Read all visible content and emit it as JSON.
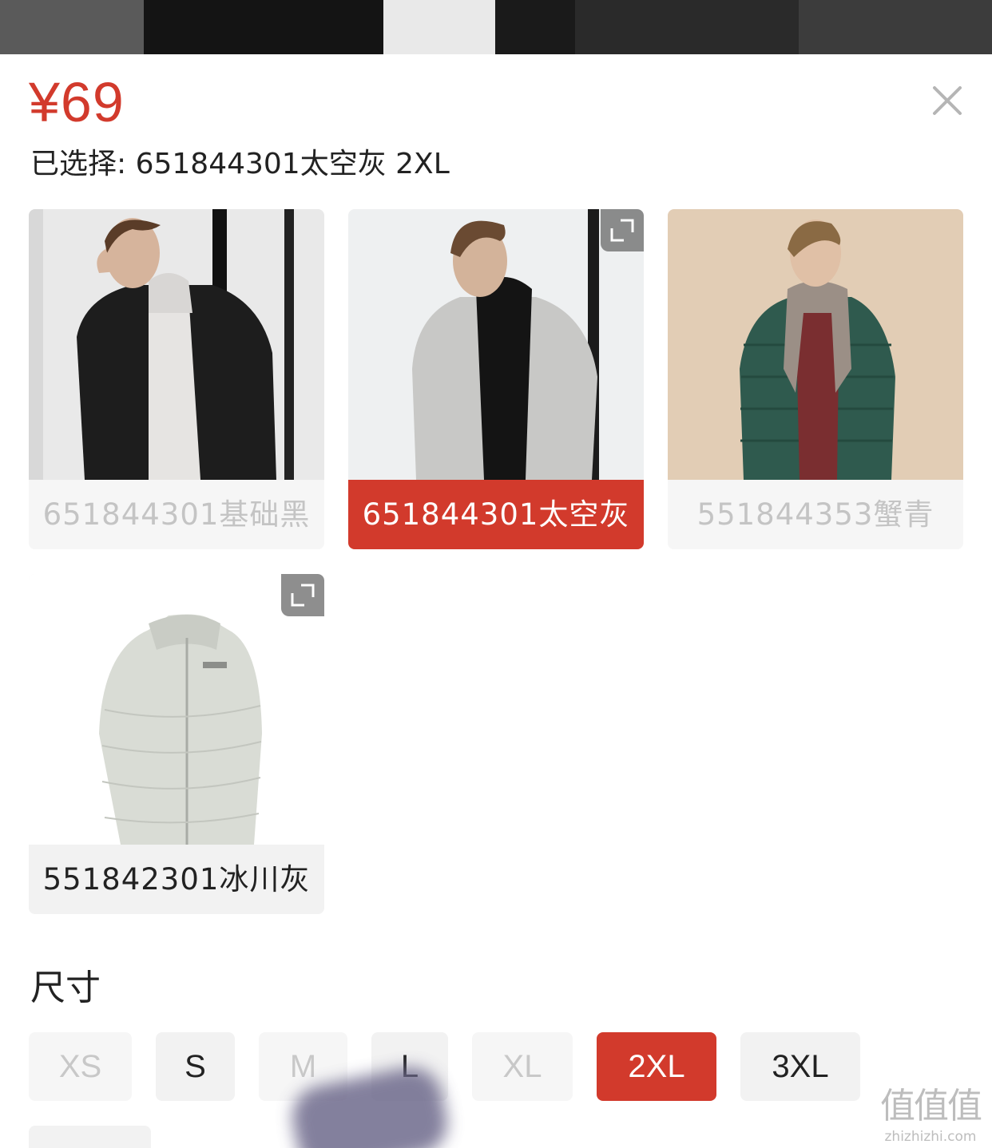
{
  "price": "¥69",
  "selection_text": "已选择: 651844301太空灰 2XL",
  "colors": [
    {
      "label": "651844301基础黑",
      "state": "disabled"
    },
    {
      "label": "651844301太空灰",
      "state": "active"
    },
    {
      "label": "551844353蟹青",
      "state": "disabled"
    },
    {
      "label": "551842301冰川灰",
      "state": "normal"
    }
  ],
  "size_section_title": "尺寸",
  "sizes": [
    {
      "label": "XS",
      "state": "disabled"
    },
    {
      "label": "S",
      "state": "normal"
    },
    {
      "label": "M",
      "state": "disabled"
    },
    {
      "label": "L",
      "state": "normal"
    },
    {
      "label": "XL",
      "state": "disabled"
    },
    {
      "label": "2XL",
      "state": "active"
    },
    {
      "label": "3XL",
      "state": "normal"
    }
  ],
  "watermark": {
    "logo": "值值值",
    "url": "zhizhizhi.com"
  },
  "theme": {
    "accent": "#d23a2c"
  }
}
